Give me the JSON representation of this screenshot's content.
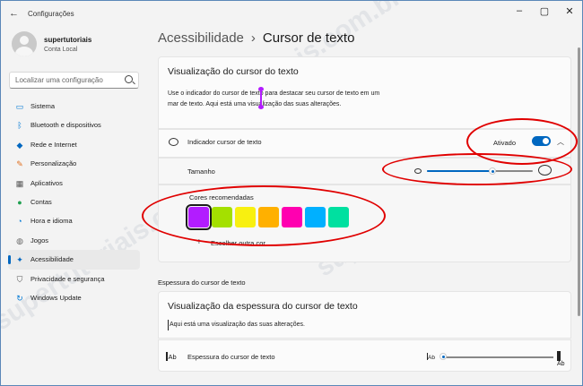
{
  "window": {
    "title": "Configurações",
    "back_icon": "back-arrow-icon"
  },
  "window_controls": [
    "minimize",
    "maximize",
    "close"
  ],
  "profile": {
    "name": "supertutoriais",
    "subtitle": "Conta Local"
  },
  "search": {
    "placeholder": "Localizar uma configuração"
  },
  "sidebar": {
    "items": [
      {
        "label": "Sistema",
        "icon": "monitor-icon",
        "color": "#0078d4"
      },
      {
        "label": "Bluetooth e dispositivos",
        "icon": "bluetooth-icon",
        "color": "#0078d4"
      },
      {
        "label": "Rede e Internet",
        "icon": "wifi-icon",
        "color": "#0067c0"
      },
      {
        "label": "Personalização",
        "icon": "brush-icon",
        "color": "#e07020"
      },
      {
        "label": "Aplicativos",
        "icon": "apps-icon",
        "color": "#555555"
      },
      {
        "label": "Contas",
        "icon": "person-icon",
        "color": "#20a050"
      },
      {
        "label": "Hora e idioma",
        "icon": "clock-globe-icon",
        "color": "#0078d4"
      },
      {
        "label": "Jogos",
        "icon": "gamepad-icon",
        "color": "#666666"
      },
      {
        "label": "Acessibilidade",
        "icon": "accessibility-icon",
        "color": "#0067c0",
        "active": true
      },
      {
        "label": "Privacidade e segurança",
        "icon": "shield-icon",
        "color": "#555555"
      },
      {
        "label": "Windows Update",
        "icon": "update-icon",
        "color": "#0078d4"
      }
    ]
  },
  "breadcrumb": {
    "parent": "Acessibilidade",
    "separator": "›",
    "current": "Cursor de texto"
  },
  "preview_card": {
    "title": "Visualização do cursor do texto",
    "description": "Use o indicador do cursor de texto para destacar seu cursor de texto em um mar de texto. Aqui está uma visualização das suas alterações."
  },
  "indicator_row": {
    "label": "Indicador cursor de texto",
    "toggle_label": "Ativado",
    "toggle_on": true
  },
  "size_row": {
    "label": "Tamanho",
    "value_fraction": 0.62
  },
  "colors_row": {
    "label": "Cores recomendadas",
    "swatches": [
      "#b21cff",
      "#a4e000",
      "#f8f010",
      "#ffb000",
      "#ff00b0",
      "#00b0ff",
      "#00e0a0"
    ],
    "selected_index": 0,
    "add_label": "Escolher outra cor"
  },
  "thickness_section": {
    "section_label": "Espessura do cursor de texto",
    "card_title": "Visualização da espessura do cursor de texto",
    "card_description": "Aqui está uma visualização das suas alterações.",
    "row_label": "Espessura do cursor de texto",
    "icon_text": "Ab",
    "slider_small_label": "Ab",
    "slider_big_label": "Ab",
    "value_fraction": 0.0
  },
  "watermark": "supertutoriais.com.br"
}
